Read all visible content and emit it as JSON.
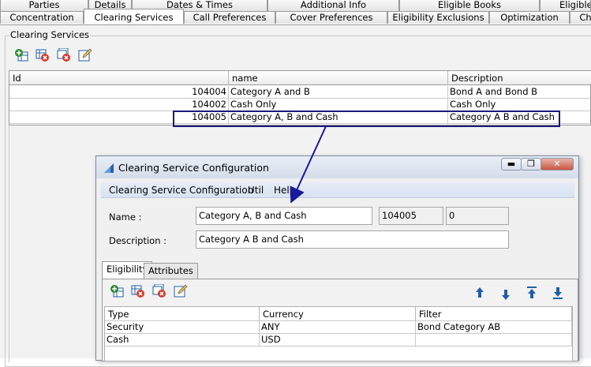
{
  "tabs_row1": [
    "Parties",
    "Details",
    "Dates & Times",
    "Additional Info",
    "Eligible Books",
    "Eligible C"
  ],
  "tabs_row2": [
    "Concentration",
    "Clearing Services",
    "Call Preferences",
    "Cover Preferences",
    "Eligibility Exclusions",
    "Optimization",
    "Ch"
  ],
  "active_tab": "Clearing Services",
  "group_title": "Clearing Services",
  "toolbar_icons": [
    "add-icon",
    "delete-icon",
    "delete-all-icon",
    "edit-icon"
  ],
  "services_table": {
    "headers": [
      "Id",
      "name",
      "Description"
    ],
    "rows": [
      {
        "id": "104004",
        "name": "Category A and B",
        "description": "Bond A and Bond B"
      },
      {
        "id": "104002",
        "name": "Cash Only",
        "description": "Cash Only"
      },
      {
        "id": "104005",
        "name": "Category A, B and Cash",
        "description": "Category A B and Cash"
      }
    ],
    "highlighted_row": 2,
    "highlight_color": "#1a1a7a"
  },
  "dialog": {
    "title": "Clearing Service Configuration",
    "menu": [
      "Clearing Service Configuration",
      "Util",
      "Help"
    ],
    "name_label": "Name :",
    "name_value": "Category A, B and Cash",
    "id_value": "104005",
    "version_value": "0",
    "description_label": "Description :",
    "description_value": "Category A B and Cash",
    "tabs": [
      "Eligibility",
      "Attributes"
    ],
    "active_tab": "Eligibility",
    "move_icons": [
      "move-up-icon",
      "move-down-icon",
      "move-top-icon",
      "move-bottom-icon"
    ],
    "eligibility_table": {
      "headers": [
        "Type",
        "Currency",
        "Filter"
      ],
      "rows": [
        {
          "type": "Security",
          "currency": "ANY",
          "filter": "Bond Category AB"
        },
        {
          "type": "Cash",
          "currency": "USD",
          "filter": ""
        }
      ]
    }
  },
  "colors": {
    "accent": "#1a1a9a",
    "icon_green": "#2e8b2e",
    "icon_red": "#d33a2a",
    "icon_blue": "#1f5fa8"
  }
}
